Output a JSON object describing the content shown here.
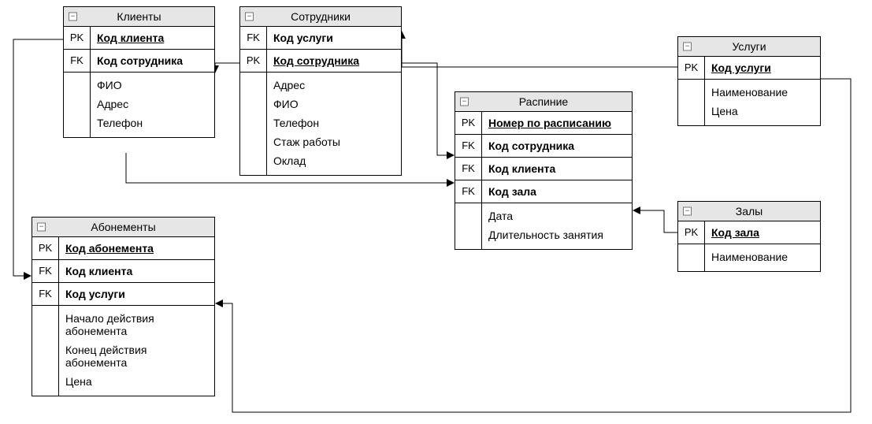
{
  "tables": {
    "clients": {
      "title": "Клиенты",
      "pk": "Код клиента",
      "fk1": "Код сотрудника",
      "attrs": [
        "ФИО",
        "Адрес",
        "Телефон"
      ]
    },
    "employees": {
      "title": "Сотрудники",
      "fk1": "Код услуги",
      "pk": "Код сотрудника",
      "attrs": [
        "Адрес",
        "ФИО",
        "Телефон",
        "Стаж работы",
        "Оклад"
      ]
    },
    "services": {
      "title": "Услуги",
      "pk": "Код услуги",
      "attrs": [
        "Наименование",
        "Цена"
      ]
    },
    "schedule": {
      "title": "Распиние",
      "pk": "Номер по расписанию",
      "fk1": "Код сотрудника",
      "fk2": "Код клиента",
      "fk3": "Код зала",
      "attrs": [
        "Дата",
        "Длительность занятия"
      ]
    },
    "halls": {
      "title": "Залы",
      "pk": "Код зала",
      "attrs": [
        "Наименование"
      ]
    },
    "subscriptions": {
      "title": "Абонементы",
      "pk": "Код абонемента",
      "fk1": "Код клиента",
      "fk2": "Код услуги",
      "attrs": [
        "Начало действия абонемента",
        "Конец действия абонемента",
        "Цена"
      ]
    }
  },
  "keyLabels": {
    "pk": "PK",
    "fk": "FK"
  },
  "icons": {
    "collapse": "−"
  }
}
